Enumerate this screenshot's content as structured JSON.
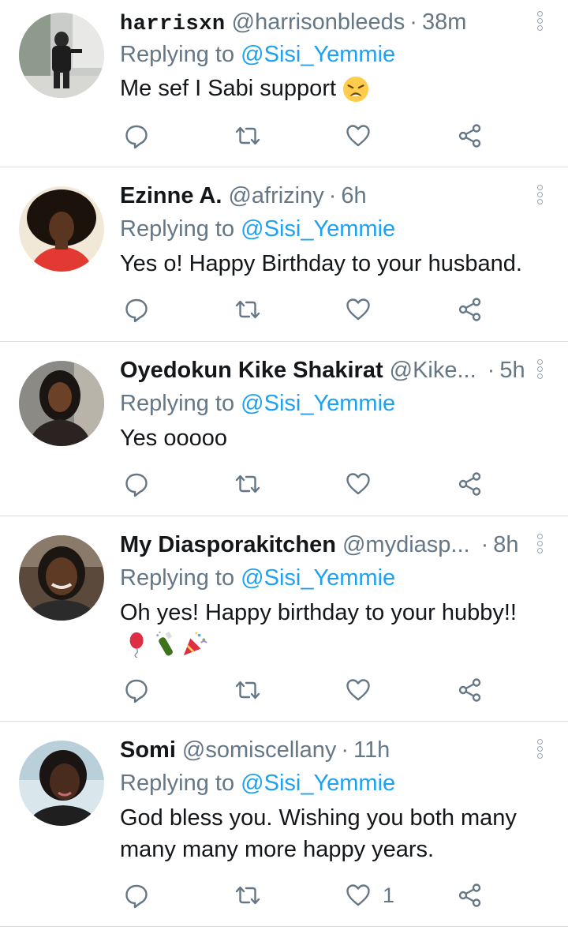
{
  "tweets": [
    {
      "name": "harrisxn",
      "handle": "@harrisonbleeds",
      "time": "38m",
      "replying_prefix": "Replying to",
      "replying_to": "@Sisi_Yemmie",
      "text": "Me sef I Sabi support",
      "emoji": "weary-face",
      "like_count": ""
    },
    {
      "name": "Ezinne A.",
      "handle": "@afriziny",
      "time": "6h",
      "replying_prefix": "Replying to",
      "replying_to": "@Sisi_Yemmie",
      "text": "Yes o! Happy Birthday to your husband.",
      "like_count": ""
    },
    {
      "name": "Oyedokun Kike Shakirat",
      "handle": "@Kike...",
      "time": "5h",
      "replying_prefix": "Replying to",
      "replying_to": "@Sisi_Yemmie",
      "text": "Yes ooooo",
      "like_count": ""
    },
    {
      "name": "My Diasporakitchen",
      "handle": "@mydiasp...",
      "time": "8h",
      "replying_prefix": "Replying to",
      "replying_to": "@Sisi_Yemmie",
      "text": "Oh yes! Happy birthday to your hubby!!",
      "emojis": [
        "balloon",
        "champagne",
        "party-popper"
      ],
      "like_count": ""
    },
    {
      "name": "Somi",
      "handle": "@somiscellany",
      "time": "11h",
      "replying_prefix": "Replying to",
      "replying_to": "@Sisi_Yemmie",
      "text": "God bless you. Wishing you both many many many more happy years.",
      "like_count": "1"
    }
  ],
  "colors": {
    "link": "#1da1f2",
    "muted": "#657786",
    "text": "#14171a",
    "divider": "#dcdfe2"
  },
  "icons": [
    "reply-icon",
    "retweet-icon",
    "like-icon",
    "share-icon",
    "more-options-icon"
  ]
}
